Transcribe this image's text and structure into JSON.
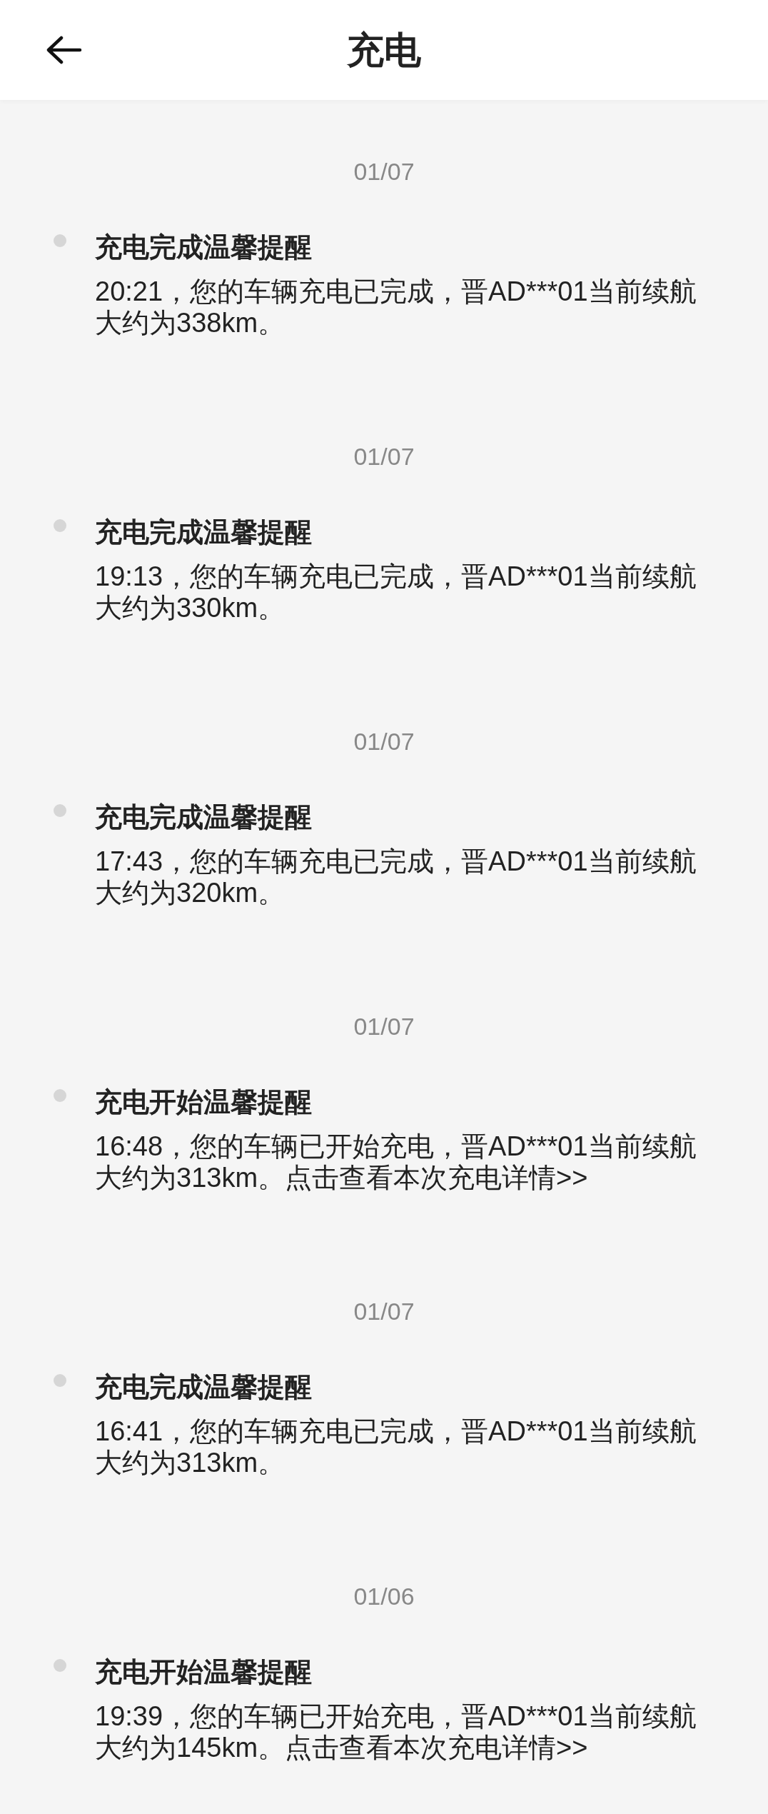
{
  "header": {
    "title": "充电"
  },
  "messages": [
    {
      "date": "01/07",
      "title": "充电完成温馨提醒",
      "body": "20:21，您的车辆充电已完成，晋AD***01当前续航大约为338km。"
    },
    {
      "date": "01/07",
      "title": "充电完成温馨提醒",
      "body": "19:13，您的车辆充电已完成，晋AD***01当前续航大约为330km。"
    },
    {
      "date": "01/07",
      "title": "充电完成温馨提醒",
      "body": "17:43，您的车辆充电已完成，晋AD***01当前续航大约为320km。"
    },
    {
      "date": "01/07",
      "title": "充电开始温馨提醒",
      "body": "16:48，您的车辆已开始充电，晋AD***01当前续航大约为313km。点击查看本次充电详情>>"
    },
    {
      "date": "01/07",
      "title": "充电完成温馨提醒",
      "body": "16:41，您的车辆充电已完成，晋AD***01当前续航大约为313km。"
    },
    {
      "date": "01/06",
      "title": "充电开始温馨提醒",
      "body": "19:39，您的车辆已开始充电，晋AD***01当前续航大约为145km。点击查看本次充电详情>>"
    }
  ]
}
